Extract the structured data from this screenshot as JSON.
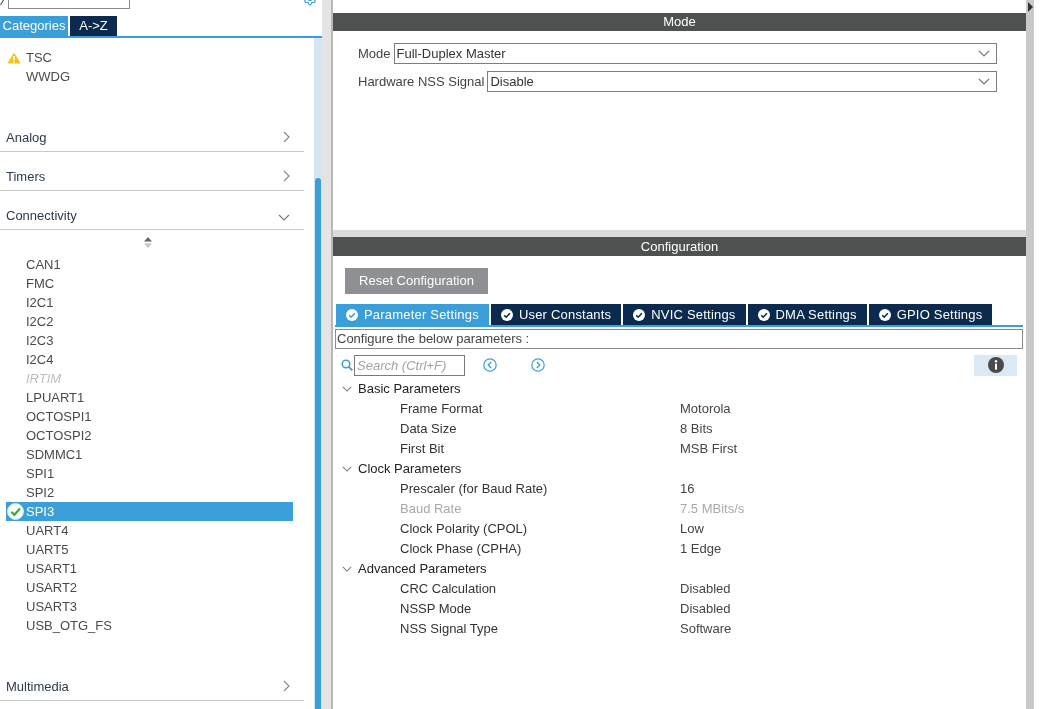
{
  "sidebar": {
    "tabs": [
      {
        "label": "Categories",
        "selected": true
      },
      {
        "label": "A->Z",
        "selected": false
      }
    ],
    "items_above": [
      {
        "label": "TSC",
        "warning": true,
        "configured": false,
        "selected": false,
        "disabled": false
      },
      {
        "label": "WWDG",
        "warning": false,
        "configured": false,
        "selected": false,
        "disabled": false
      }
    ],
    "categories": [
      {
        "label": "Analog",
        "expanded": false
      },
      {
        "label": "Timers",
        "expanded": false
      },
      {
        "label": "Connectivity",
        "expanded": true,
        "children": [
          {
            "label": "CAN1",
            "warning": false,
            "configured": false,
            "selected": false,
            "disabled": false
          },
          {
            "label": "FMC",
            "warning": false,
            "configured": false,
            "selected": false,
            "disabled": false
          },
          {
            "label": "I2C1",
            "warning": false,
            "configured": false,
            "selected": false,
            "disabled": false
          },
          {
            "label": "I2C2",
            "warning": false,
            "configured": false,
            "selected": false,
            "disabled": false
          },
          {
            "label": "I2C3",
            "warning": false,
            "configured": false,
            "selected": false,
            "disabled": false
          },
          {
            "label": "I2C4",
            "warning": false,
            "configured": false,
            "selected": false,
            "disabled": false
          },
          {
            "label": "IRTIM",
            "warning": false,
            "configured": false,
            "selected": false,
            "disabled": true
          },
          {
            "label": "LPUART1",
            "warning": false,
            "configured": false,
            "selected": false,
            "disabled": false
          },
          {
            "label": "OCTOSPI1",
            "warning": false,
            "configured": false,
            "selected": false,
            "disabled": false
          },
          {
            "label": "OCTOSPI2",
            "warning": false,
            "configured": false,
            "selected": false,
            "disabled": false
          },
          {
            "label": "SDMMC1",
            "warning": false,
            "configured": false,
            "selected": false,
            "disabled": false
          },
          {
            "label": "SPI1",
            "warning": false,
            "configured": false,
            "selected": false,
            "disabled": false
          },
          {
            "label": "SPI2",
            "warning": false,
            "configured": false,
            "selected": false,
            "disabled": false
          },
          {
            "label": "SPI3",
            "warning": false,
            "configured": true,
            "selected": true,
            "disabled": false
          },
          {
            "label": "UART4",
            "warning": false,
            "configured": false,
            "selected": false,
            "disabled": false
          },
          {
            "label": "UART5",
            "warning": false,
            "configured": false,
            "selected": false,
            "disabled": false
          },
          {
            "label": "USART1",
            "warning": false,
            "configured": false,
            "selected": false,
            "disabled": false
          },
          {
            "label": "USART2",
            "warning": false,
            "configured": false,
            "selected": false,
            "disabled": false
          },
          {
            "label": "USART3",
            "warning": false,
            "configured": false,
            "selected": false,
            "disabled": false
          },
          {
            "label": "USB_OTG_FS",
            "warning": false,
            "configured": false,
            "selected": false,
            "disabled": false
          }
        ]
      },
      {
        "label": "Multimedia",
        "expanded": false
      }
    ]
  },
  "mode": {
    "header": "Mode",
    "fields": [
      {
        "label": "Mode",
        "value": "Full-Duplex Master"
      },
      {
        "label": "Hardware NSS Signal",
        "value": "Disable"
      }
    ]
  },
  "configuration": {
    "header": "Configuration",
    "reset_button": "Reset Configuration",
    "tabs": [
      {
        "label": "Parameter Settings",
        "selected": true
      },
      {
        "label": "User Constants",
        "selected": false
      },
      {
        "label": "NVIC Settings",
        "selected": false
      },
      {
        "label": "DMA Settings",
        "selected": false
      },
      {
        "label": "GPIO Settings",
        "selected": false
      }
    ],
    "instruction": "Configure the below parameters :",
    "search": {
      "placeholder": "Search (Ctrl+F)"
    },
    "groups": [
      {
        "label": "Basic Parameters",
        "expanded": true,
        "children": [
          {
            "label": "Frame Format",
            "value": "Motorola",
            "disabled": false
          },
          {
            "label": "Data Size",
            "value": "8 Bits",
            "disabled": false
          },
          {
            "label": "First Bit",
            "value": "MSB First",
            "disabled": false
          }
        ]
      },
      {
        "label": "Clock Parameters",
        "expanded": true,
        "children": [
          {
            "label": "Prescaler (for Baud Rate)",
            "value": "16",
            "disabled": false
          },
          {
            "label": "Baud Rate",
            "value": "7.5 MBits/s",
            "disabled": true
          },
          {
            "label": "Clock Polarity (CPOL)",
            "value": "Low",
            "disabled": false
          },
          {
            "label": "Clock Phase (CPHA)",
            "value": "1 Edge",
            "disabled": false
          }
        ]
      },
      {
        "label": "Advanced Parameters",
        "expanded": true,
        "children": [
          {
            "label": "CRC Calculation",
            "value": "Disabled",
            "disabled": false
          },
          {
            "label": "NSSP Mode",
            "value": "Disabled",
            "disabled": false
          },
          {
            "label": "NSS Signal Type",
            "value": "Software",
            "disabled": false
          }
        ]
      }
    ]
  }
}
